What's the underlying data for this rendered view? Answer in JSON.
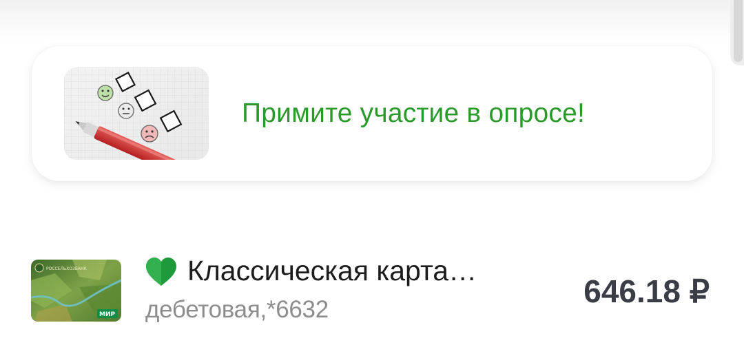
{
  "survey": {
    "image_icon": "survey-checklist-image",
    "text": "Примите участие в опросе!"
  },
  "account": {
    "name": "Классическая карта…",
    "subtitle": "дебетовая,*6632",
    "balance": "646.18 ₽",
    "favorite_icon": "green-heart-icon",
    "card_icon": "bank-card-image",
    "card_brand": "МИР",
    "bank_logo_text": "РОССЕЛЬХОЗБАНК"
  },
  "colors": {
    "accent_green": "#2b9a2b",
    "heart_green": "#1e9a3c",
    "balance_text": "#3a3c46",
    "subtitle_text": "#8d8d8d"
  }
}
